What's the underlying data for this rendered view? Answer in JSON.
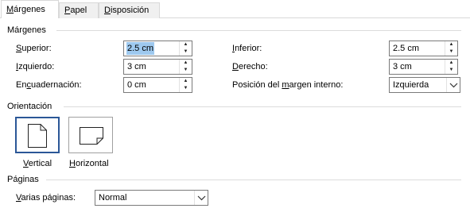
{
  "tabs": [
    {
      "pre": "",
      "key": "M",
      "post": "árgenes"
    },
    {
      "pre": "",
      "key": "P",
      "post": "apel"
    },
    {
      "pre": "",
      "key": "D",
      "post": "isposición"
    }
  ],
  "margins": {
    "title": "Márgenes",
    "top": {
      "pre": "",
      "key": "S",
      "post": "uperior:",
      "value": "2.5 cm"
    },
    "bottom": {
      "pre": "",
      "key": "I",
      "post": "nferior:",
      "value": "2.5 cm"
    },
    "left": {
      "pre": "",
      "key": "I",
      "post": "zquierdo:",
      "value": "3 cm"
    },
    "right": {
      "pre": "",
      "key": "D",
      "post": "erecho:",
      "value": "3 cm"
    },
    "gutter": {
      "pre": "En",
      "key": "c",
      "post": "uadernación:",
      "value": "0 cm"
    },
    "gutter_position": {
      "pre": "Posición del ",
      "key": "m",
      "post": "argen interno:",
      "value": "Izquierda"
    }
  },
  "orientation": {
    "title": "Orientación",
    "portrait": {
      "pre": "",
      "key": "V",
      "post": "ertical"
    },
    "landscape": {
      "pre": "",
      "key": "H",
      "post": "orizontal"
    }
  },
  "pages": {
    "title": "Páginas",
    "multiple": {
      "pre": "",
      "key": "V",
      "post": "arias páginas:",
      "value": "Normal"
    }
  }
}
